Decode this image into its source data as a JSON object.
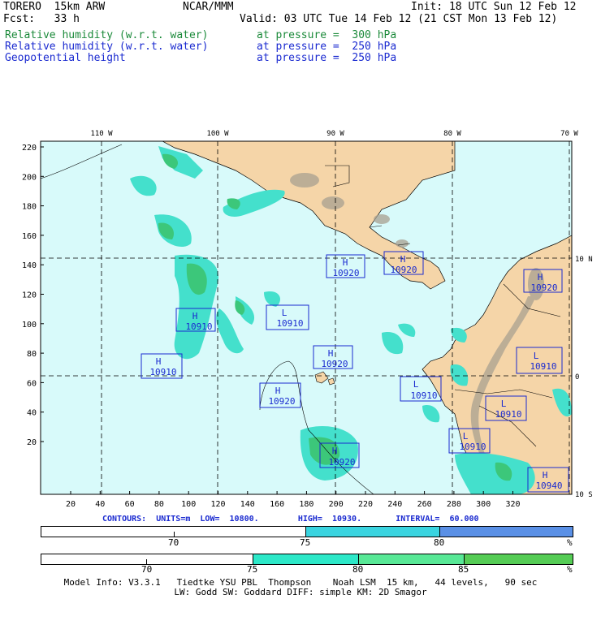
{
  "header": {
    "model": "TORERO  15km ARW",
    "center": "NCAR/MMM",
    "init": "Init: 18 UTC Sun 12 Feb 12",
    "fcst": "Fcst:   33 h",
    "valid": "Valid: 03 UTC Tue 14 Feb 12 (21 CST Mon 13 Feb 12)",
    "fields": [
      {
        "name": "Relative humidity (w.r.t. water)",
        "level": "at pressure =  300 hPa",
        "color": "#1b8a3a"
      },
      {
        "name": "Relative humidity (w.r.t. water)",
        "level": "at pressure =  250 hPa",
        "color": "#1a2ad0"
      },
      {
        "name": "Geopotential height",
        "level": "at pressure =  250 hPa",
        "color": "#1a2ad0"
      }
    ]
  },
  "map": {
    "top_lon_labels": [
      "110 W",
      "100 W",
      "90 W",
      "80 W",
      "70 W"
    ],
    "right_lat_labels": [
      "10 N",
      "0",
      "10 S"
    ],
    "y_ticks": [
      "220",
      "200",
      "180",
      "160",
      "140",
      "120",
      "100",
      "80",
      "60",
      "40",
      "20"
    ],
    "x_ticks": [
      "20",
      "40",
      "60",
      "80",
      "100",
      "120",
      "140",
      "160",
      "180",
      "200",
      "220",
      "240",
      "260",
      "280",
      "300",
      "320"
    ],
    "highs_lows": [
      {
        "letter": "H",
        "value": "10920"
      },
      {
        "letter": "H",
        "value": "10920"
      },
      {
        "letter": "H",
        "value": "10920"
      },
      {
        "letter": "H",
        "value": "10910"
      },
      {
        "letter": "L",
        "value": "10910"
      },
      {
        "letter": "H",
        "value": "10910"
      },
      {
        "letter": "H",
        "value": "10920"
      },
      {
        "letter": "H",
        "value": "10920"
      },
      {
        "letter": "L",
        "value": "10910"
      },
      {
        "letter": "L",
        "value": "10910"
      },
      {
        "letter": "L",
        "value": "10910"
      },
      {
        "letter": "L",
        "value": "10910"
      },
      {
        "letter": "H",
        "value": "10920"
      },
      {
        "letter": "H",
        "value": "10940"
      }
    ],
    "colors": {
      "ocean": "#d8fafa",
      "land": "#f5d5a8",
      "terrain": "#a8a090",
      "rh75": "#44e0cc",
      "rh85": "#3cc77a"
    }
  },
  "contours_line": "CONTOURS:  UNITS=m  LOW=  10800.        HIGH=  10930.       INTERVAL=  60.000",
  "colorbar1": {
    "labels": [
      "70",
      "75",
      "80"
    ],
    "unit": "%",
    "colors": [
      "#ffffff",
      "#3ad4e0",
      "#5a90e6"
    ]
  },
  "colorbar2": {
    "labels": [
      "70",
      "75",
      "80",
      "85"
    ],
    "unit": "%",
    "colors": [
      "#ffffff",
      "#2de8c8",
      "#58e896",
      "#55cc55"
    ]
  },
  "footer": {
    "line1": "Model Info: V3.3.1   Tiedtke YSU PBL  Thompson    Noah LSM  15 km,   44 levels,   90 sec",
    "line2": "LW: Godd SW: Goddard DIFF: simple KM: 2D Smagor"
  }
}
